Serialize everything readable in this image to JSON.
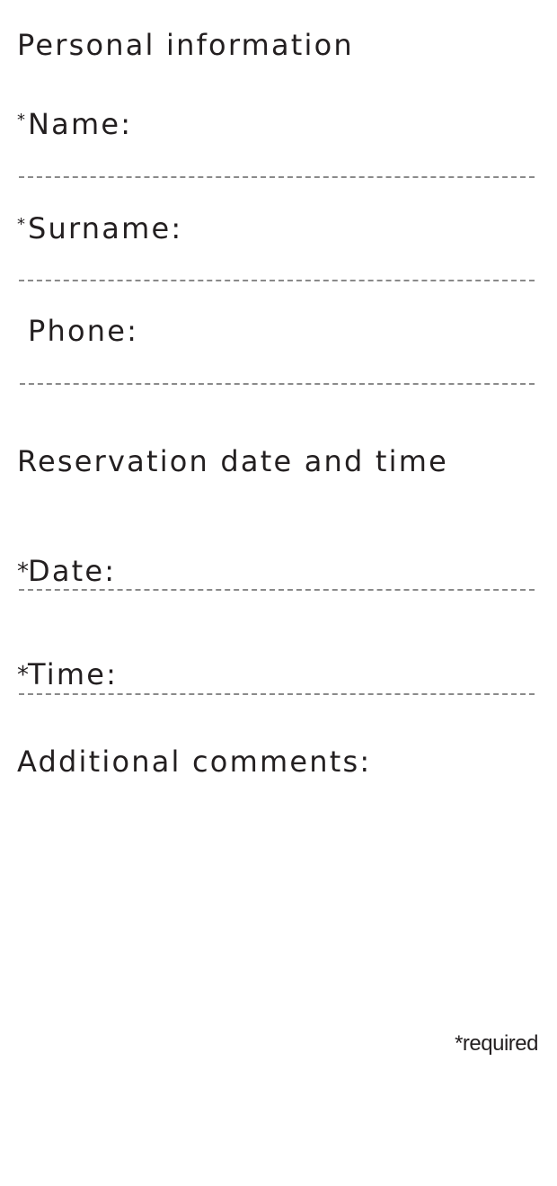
{
  "personal": {
    "title": "Personal information",
    "name": {
      "marker": "*",
      "label": "Name:",
      "value": ""
    },
    "surname": {
      "marker": "*",
      "label": "Surname:",
      "value": ""
    },
    "phone": {
      "label": "Phone:",
      "value": ""
    }
  },
  "reservation": {
    "title": "Reservation date and time",
    "date": {
      "marker": "*",
      "label": "Date:",
      "value": ""
    },
    "time": {
      "marker": "*",
      "label": "Time:",
      "value": ""
    }
  },
  "comments": {
    "label": "Additional comments:",
    "value": ""
  },
  "footer": {
    "required_note": "*required"
  }
}
